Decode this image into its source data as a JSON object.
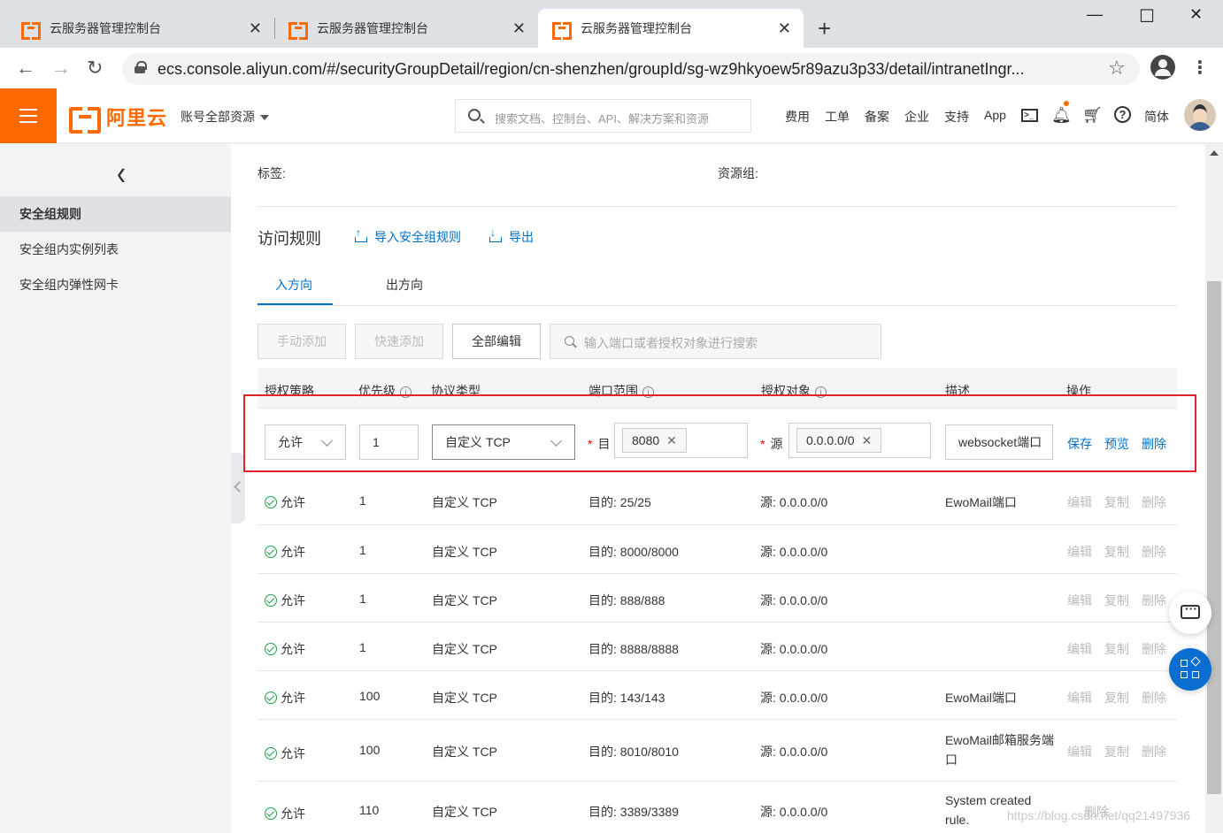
{
  "browser": {
    "tabs": [
      {
        "title": "云服务器管理控制台"
      },
      {
        "title": "云服务器管理控制台"
      },
      {
        "title": "云服务器管理控制台"
      }
    ],
    "new_tab": "+",
    "url": "ecs.console.aliyun.com/#/securityGroupDetail/region/cn-shenzhen/groupId/sg-wz9hkyoew5r89azu3p33/detail/intranetIngr..."
  },
  "header": {
    "logo_text": "阿里云",
    "account_scope": "账号全部资源",
    "search_placeholder": "搜索文档、控制台、API、解决方案和资源",
    "nav": [
      "费用",
      "工单",
      "备案",
      "企业",
      "支持",
      "App"
    ],
    "language": "简体",
    "accent_color": "#ff6a00"
  },
  "sidebar": {
    "items": [
      {
        "label": "安全组规则",
        "active": true
      },
      {
        "label": "安全组内实例列表",
        "active": false
      },
      {
        "label": "安全组内弹性网卡",
        "active": false
      }
    ]
  },
  "main": {
    "tag_label": "标签:",
    "resource_group_label": "资源组:",
    "section_title": "访问规则",
    "import_link": "导入安全组规则",
    "export_link": "导出",
    "direction_tabs": [
      {
        "label": "入方向",
        "active": true
      },
      {
        "label": "出方向",
        "active": false
      }
    ],
    "toolbar": {
      "manual_add": "手动添加",
      "quick_add": "快速添加",
      "bulk_edit": "全部编辑",
      "search_placeholder": "输入端口或者授权对象进行搜索"
    },
    "columns": {
      "policy": "授权策略",
      "priority": "优先级",
      "protocol": "协议类型",
      "port_range": "端口范围",
      "auth_object": "授权对象",
      "description": "描述",
      "actions": "操作"
    },
    "edit_row": {
      "policy": "允许",
      "priority": "1",
      "protocol": "自定义 TCP",
      "port_label": "目",
      "port_tag": "8080",
      "source_label": "源",
      "source_tag": "0.0.0.0/0",
      "description": "websocket端口",
      "save": "保存",
      "preview": "预览",
      "delete": "删除"
    },
    "row_actions": {
      "edit": "编辑",
      "copy": "复制",
      "delete": "删除"
    },
    "rows": [
      {
        "policy": "允许",
        "priority": "1",
        "protocol": "自定义 TCP",
        "port": "目的: 25/25",
        "source": "源: 0.0.0.0/0",
        "description": "EwoMail端口"
      },
      {
        "policy": "允许",
        "priority": "1",
        "protocol": "自定义 TCP",
        "port": "目的: 8000/8000",
        "source": "源: 0.0.0.0/0",
        "description": ""
      },
      {
        "policy": "允许",
        "priority": "1",
        "protocol": "自定义 TCP",
        "port": "目的: 888/888",
        "source": "源: 0.0.0.0/0",
        "description": ""
      },
      {
        "policy": "允许",
        "priority": "1",
        "protocol": "自定义 TCP",
        "port": "目的: 8888/8888",
        "source": "源: 0.0.0.0/0",
        "description": ""
      },
      {
        "policy": "允许",
        "priority": "100",
        "protocol": "自定义 TCP",
        "port": "目的: 143/143",
        "source": "源: 0.0.0.0/0",
        "description": "EwoMail端口"
      },
      {
        "policy": "允许",
        "priority": "100",
        "protocol": "自定义 TCP",
        "port": "目的: 8010/8010",
        "source": "源: 0.0.0.0/0",
        "description": "EwoMail邮箱服务端口"
      },
      {
        "policy": "允许",
        "priority": "110",
        "protocol": "自定义 TCP",
        "port": "目的: 3389/3389",
        "source": "源: 0.0.0.0/0",
        "description": "System created rule."
      }
    ],
    "watermark": "https://blog.csdn.net/qq21497936"
  }
}
